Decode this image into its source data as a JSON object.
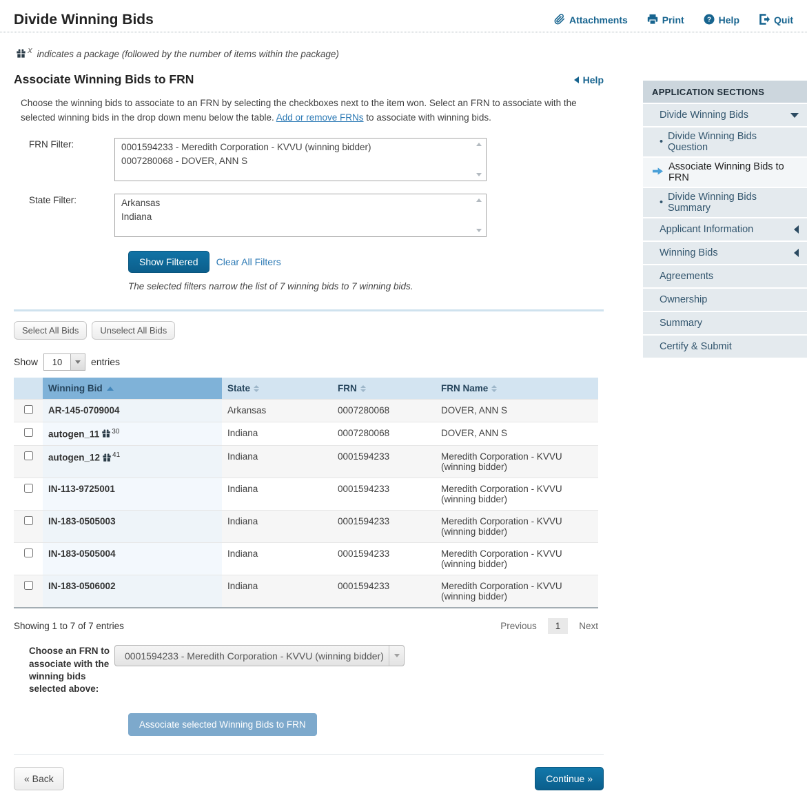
{
  "page": {
    "title": "Divide Winning Bids"
  },
  "toolbar": {
    "attachments": {
      "label": "Attachments",
      "icon": "paperclip-icon"
    },
    "print": {
      "label": "Print",
      "icon": "printer-icon"
    },
    "help": {
      "label": "Help",
      "icon": "question-circle-icon"
    },
    "quit": {
      "label": "Quit",
      "icon": "exit-icon"
    }
  },
  "package_note": {
    "icon": "package-gift-icon",
    "sup": "X",
    "text": "indicates a package (followed by the number of items within the package)"
  },
  "section": {
    "heading": "Associate Winning Bids to FRN",
    "help_label": "Help",
    "intro_before_link": "Choose the winning bids to associate to an FRN by selecting the checkboxes next to the item won. Select an FRN to associate with the selected winning bids in the drop down menu below the table. ",
    "intro_link": "Add or remove FRNs",
    "intro_after_link": " to associate with winning bids."
  },
  "filters": {
    "frn_label": "FRN Filter:",
    "frn_options": [
      "0001594233 - Meredith Corporation - KVVU (winning bidder)",
      "0007280068 - DOVER, ANN S"
    ],
    "state_label": "State Filter:",
    "state_options": [
      "Arkansas",
      "Indiana"
    ],
    "show_filtered_label": "Show Filtered",
    "clear_all_label": "Clear All Filters",
    "summary": "The selected filters narrow the list of 7 winning bids to 7 winning bids."
  },
  "table_controls": {
    "select_all_label": "Select All Bids",
    "unselect_all_label": "Unselect All Bids",
    "show_label": "Show",
    "entries_value": "10",
    "entries_label": "entries"
  },
  "table": {
    "columns": {
      "bid": "Winning Bid",
      "state": "State",
      "frn": "FRN",
      "frn_name": "FRN Name"
    },
    "rows": [
      {
        "bid": "AR-145-0709004",
        "pkg": "",
        "state": "Arkansas",
        "frn": "0007280068",
        "frn_name": "DOVER, ANN S"
      },
      {
        "bid": "autogen_11",
        "pkg": "30",
        "state": "Indiana",
        "frn": "0007280068",
        "frn_name": "DOVER, ANN S"
      },
      {
        "bid": "autogen_12",
        "pkg": "41",
        "state": "Indiana",
        "frn": "0001594233",
        "frn_name": "Meredith Corporation - KVVU (winning bidder)"
      },
      {
        "bid": "IN-113-9725001",
        "pkg": "",
        "state": "Indiana",
        "frn": "0001594233",
        "frn_name": "Meredith Corporation - KVVU (winning bidder)"
      },
      {
        "bid": "IN-183-0505003",
        "pkg": "",
        "state": "Indiana",
        "frn": "0001594233",
        "frn_name": "Meredith Corporation - KVVU (winning bidder)"
      },
      {
        "bid": "IN-183-0505004",
        "pkg": "",
        "state": "Indiana",
        "frn": "0001594233",
        "frn_name": "Meredith Corporation - KVVU (winning bidder)"
      },
      {
        "bid": "IN-183-0506002",
        "pkg": "",
        "state": "Indiana",
        "frn": "0001594233",
        "frn_name": "Meredith Corporation - KVVU (winning bidder)"
      }
    ],
    "showing": "Showing 1 to 7 of 7 entries",
    "pagination": {
      "previous": "Previous",
      "current": "1",
      "next": "Next"
    }
  },
  "frn_select": {
    "label": "Choose an FRN to associate with the winning bids selected above:",
    "value": "0001594233 - Meredith Corporation - KVVU (winning bidder)"
  },
  "actions": {
    "associate_label": "Associate selected Winning Bids to FRN",
    "back_label": "« Back",
    "continue_label": "Continue »"
  },
  "sidebar": {
    "header": "APPLICATION SECTIONS",
    "items": [
      {
        "label": "Divide Winning Bids",
        "type": "parent",
        "state": "expanded"
      },
      {
        "label": "Divide Winning Bids Question",
        "type": "sub"
      },
      {
        "label": "Associate Winning Bids to FRN",
        "type": "sub",
        "state": "active"
      },
      {
        "label": "Divide Winning Bids Summary",
        "type": "sub"
      },
      {
        "label": "Applicant Information",
        "type": "parent",
        "state": "collapsed"
      },
      {
        "label": "Winning Bids",
        "type": "parent",
        "state": "collapsed"
      },
      {
        "label": "Agreements",
        "type": "parent"
      },
      {
        "label": "Ownership",
        "type": "parent"
      },
      {
        "label": "Summary",
        "type": "parent"
      },
      {
        "label": "Certify & Submit",
        "type": "parent"
      }
    ]
  },
  "colors": {
    "accent_blue": "#17648f",
    "button_blue": "#0e6a97",
    "muted_button_blue": "#7da9cc",
    "table_header_sorted": "#7fb2d8",
    "table_header": "#d3e4f1",
    "sidebar_header_bg": "#ccd6dd",
    "sidebar_item_bg": "#e4eaee",
    "link_blue": "#2d7ab5"
  }
}
